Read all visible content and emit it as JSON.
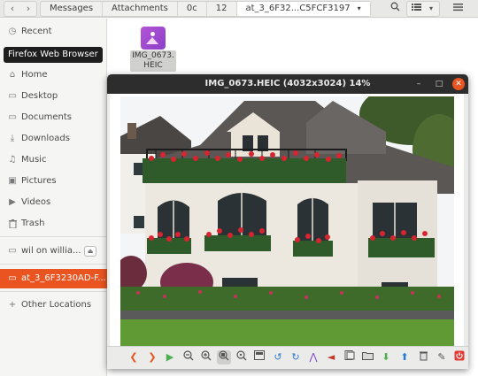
{
  "topbar": {
    "back": "‹",
    "forward": "›",
    "crumbs": [
      "Messages",
      "Attachments",
      "0c",
      "12",
      "at_3_6F32...C5FCF3197"
    ],
    "dropdown": "▾"
  },
  "sidebar": {
    "tooltip": "Firefox Web Browser",
    "items": [
      {
        "label": "Recent",
        "icon": "clock-icon",
        "glyph": "◷"
      },
      {
        "label": "Home",
        "icon": "home-icon",
        "glyph": "⌂"
      },
      {
        "label": "Desktop",
        "icon": "folder-icon",
        "glyph": "▭"
      },
      {
        "label": "Documents",
        "icon": "folder-icon",
        "glyph": "▭"
      },
      {
        "label": "Downloads",
        "icon": "download-icon",
        "glyph": "⤓"
      },
      {
        "label": "Music",
        "icon": "music-icon",
        "glyph": "♫"
      },
      {
        "label": "Pictures",
        "icon": "picture-icon",
        "glyph": "▣"
      },
      {
        "label": "Videos",
        "icon": "video-icon",
        "glyph": "▶"
      },
      {
        "label": "Trash",
        "icon": "trash-icon",
        "glyph": "🗑"
      },
      {
        "label": "wil on willia...",
        "icon": "network-drive-icon",
        "glyph": "▭"
      },
      {
        "label": "at_3_6F3230AD-F...",
        "icon": "folder-icon",
        "glyph": "▭"
      },
      {
        "label": "Other Locations",
        "icon": "plus-icon",
        "glyph": "+"
      }
    ],
    "eject": "⏏"
  },
  "file": {
    "name_line1": "IMG_0673.",
    "name_line2": "HEIC"
  },
  "viewer": {
    "title": "IMG_0673.HEIC (4032x3024) 14%",
    "minimize": "–",
    "maximize": "□",
    "close": "✕"
  },
  "colors": {
    "accent": "#e95420",
    "titlebar": "#2d2d2d"
  }
}
